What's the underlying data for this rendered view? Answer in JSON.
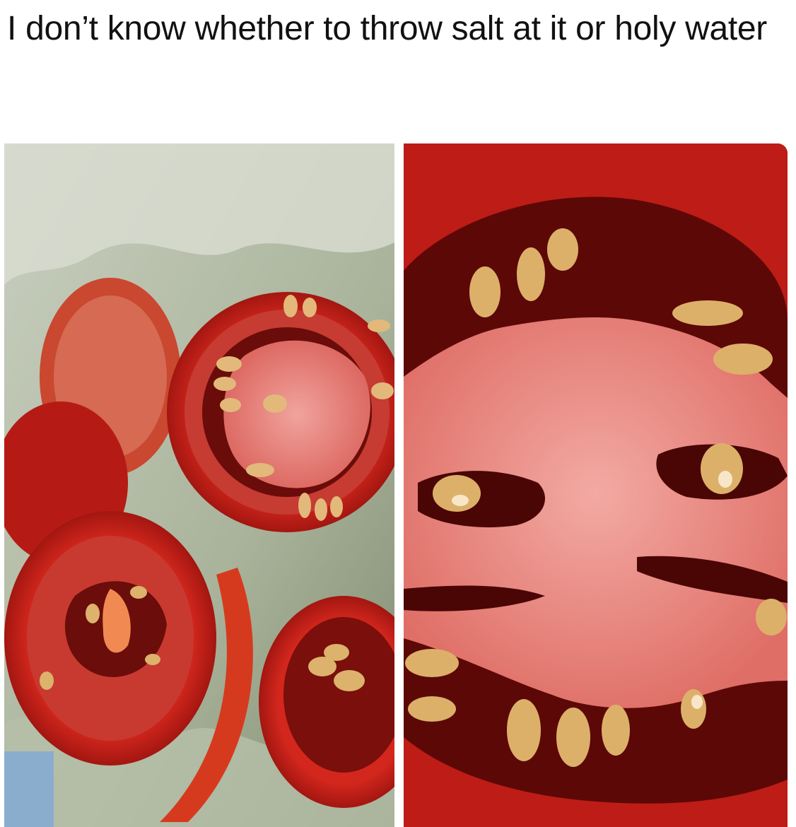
{
  "post": {
    "caption": "I don’t know whether to throw salt at it or holy water"
  },
  "images": [
    {
      "name": "tomato-slices-overview",
      "subject": "tomato slices on plastic bag"
    },
    {
      "name": "tomato-face-closeup",
      "subject": "close-up of tomato slice resembling a face"
    }
  ],
  "colors": {
    "background": "#ffffff",
    "text": "#111111",
    "tomato_red": "#c91d16",
    "flesh_pink": "#e88a86",
    "seed": "#d9b26a"
  }
}
